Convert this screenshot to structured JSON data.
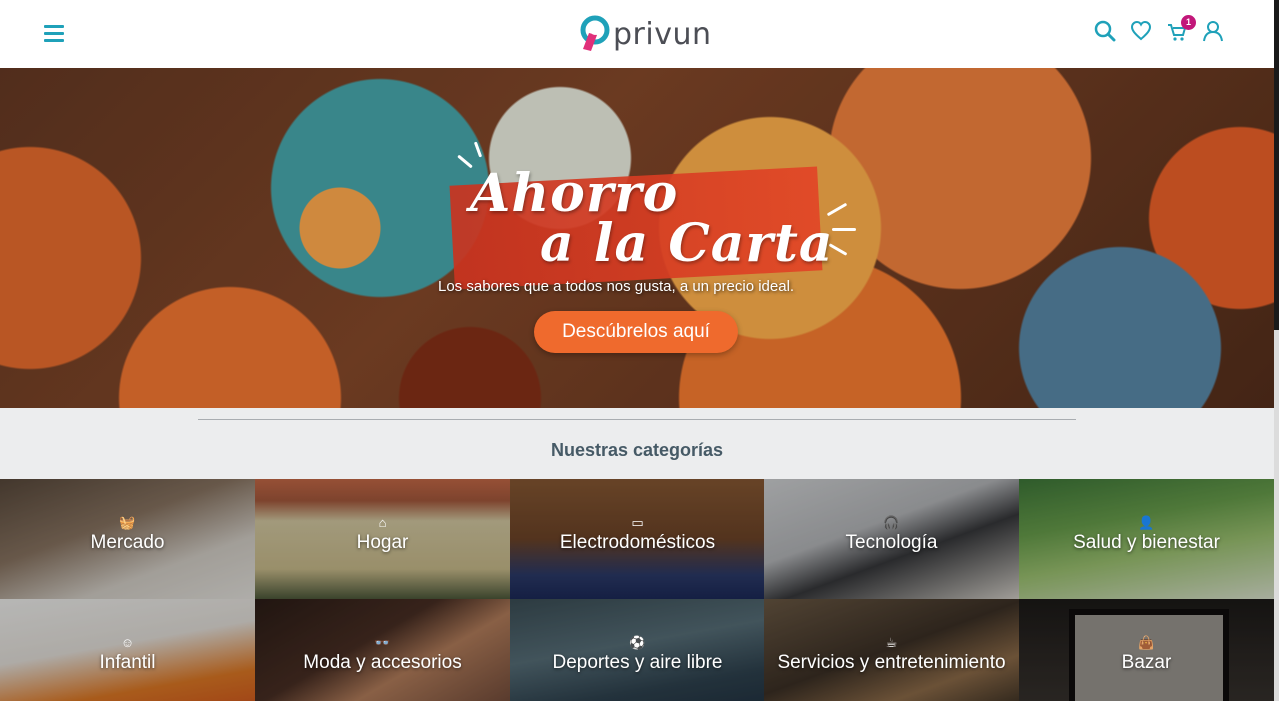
{
  "header": {
    "logo_text": "privun",
    "icons": [
      "menu-icon",
      "search-icon",
      "heart-icon",
      "cart-icon",
      "user-icon"
    ],
    "cart_count": "1"
  },
  "hero": {
    "title_line1": "Ahorro",
    "title_line2": "a la Carta",
    "subtitle": "Los sabores que a todos nos gusta, a un precio ideal.",
    "cta_label": "Descúbrelos aquí"
  },
  "categories_section": {
    "title": "Nuestras categorías",
    "items": [
      {
        "label": "Mercado",
        "icon": "basket-icon",
        "glyph": "🧺"
      },
      {
        "label": "Hogar",
        "icon": "home-icon",
        "glyph": "⌂"
      },
      {
        "label": "Electrodomésticos",
        "icon": "tv-icon",
        "glyph": "▭"
      },
      {
        "label": "Tecnología",
        "icon": "headphones-icon",
        "glyph": "🎧"
      },
      {
        "label": "Salud y bienestar",
        "icon": "person-icon",
        "glyph": "👤"
      },
      {
        "label": "Infantil",
        "icon": "baby-icon",
        "glyph": "☺"
      },
      {
        "label": "Moda y accesorios",
        "icon": "glasses-icon",
        "glyph": "👓"
      },
      {
        "label": "Deportes y aire libre",
        "icon": "ball-icon",
        "glyph": "⚽"
      },
      {
        "label": "Servicios y entretenimiento",
        "icon": "cup-icon",
        "glyph": "☕"
      },
      {
        "label": "Bazar",
        "icon": "bag-icon",
        "glyph": "👜"
      }
    ]
  },
  "colors": {
    "accent": "#1fa1b9",
    "badge": "#c2177a",
    "cta": "#ef6a2d",
    "logo_pink": "#e0307a"
  }
}
